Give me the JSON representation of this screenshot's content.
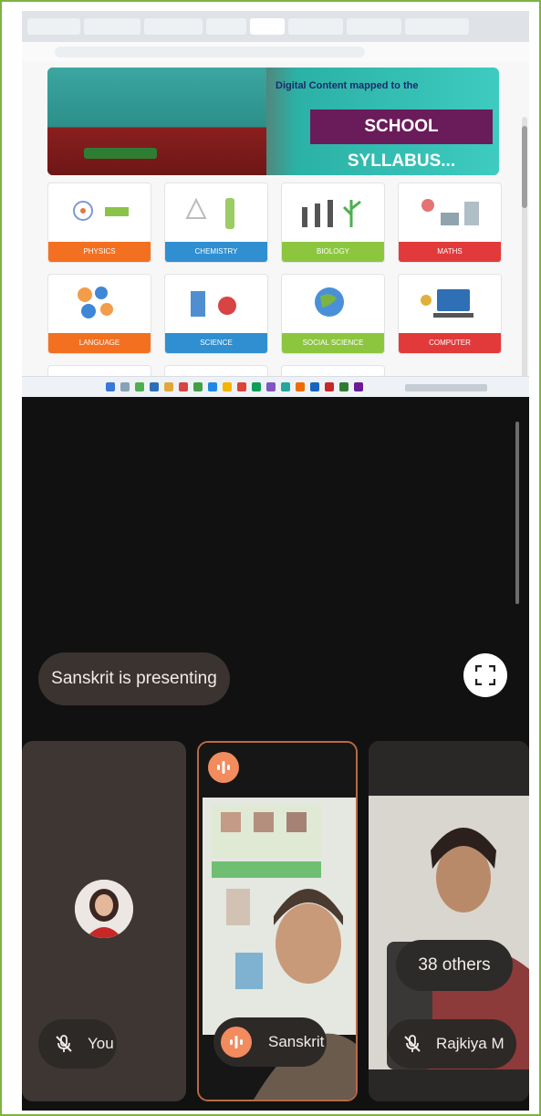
{
  "banner": {
    "subtitle": "Digital Content mapped to the",
    "title": "SCHOOL SYLLABUS..."
  },
  "subjects": [
    {
      "label": "PHYSICS",
      "color": "#f37021"
    },
    {
      "label": "CHEMISTRY",
      "color": "#2f8fd1"
    },
    {
      "label": "BIOLOGY",
      "color": "#8cc63f"
    },
    {
      "label": "MATHS",
      "color": "#e23a3a"
    },
    {
      "label": "LANGUAGE",
      "color": "#f37021"
    },
    {
      "label": "SCIENCE",
      "color": "#2f8fd1"
    },
    {
      "label": "SOCIAL SCIENCE",
      "color": "#8cc63f"
    },
    {
      "label": "COMPUTER",
      "color": "#e23a3a"
    }
  ],
  "presenting": {
    "label": "Sanskrit is presenting"
  },
  "participants": {
    "you": {
      "name": "You",
      "muted": true
    },
    "sanskrit": {
      "name": "Sanskrit",
      "speaking": true
    },
    "rajkiya": {
      "name": "Rajkiya M",
      "muted": true
    }
  },
  "others_badge": "38 others",
  "colors": {
    "tile_border_active": "#b86a45",
    "speak": "#f28b5e",
    "frame": "#7cb342"
  }
}
